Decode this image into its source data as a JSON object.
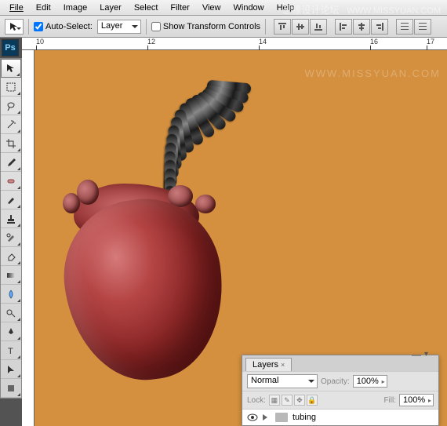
{
  "menu": {
    "file": "File",
    "edit": "Edit",
    "image": "Image",
    "layer": "Layer",
    "select": "Select",
    "filter": "Filter",
    "view": "View",
    "window": "Window",
    "help": "Help"
  },
  "options": {
    "auto_select": "Auto-Select:",
    "auto_select_checked": true,
    "layer_dropdown": "Layer",
    "show_transform": "Show Transform Controls",
    "show_transform_checked": false
  },
  "ruler_ticks": [
    "10",
    "12",
    "14",
    "16",
    "17"
  ],
  "ps_badge": "Ps",
  "watermark": {
    "site": "思缘设计论坛",
    "url": "WWW.MISSYUAN.COM",
    "faint": "WWW.MISSYUAN.COM"
  },
  "layers_panel": {
    "tab": "Layers",
    "blend_mode": "Normal",
    "opacity_label": "Opacity:",
    "opacity_value": "100%",
    "lock_label": "Lock:",
    "fill_label": "Fill:",
    "fill_value": "100%",
    "layer_name": "tubing"
  }
}
